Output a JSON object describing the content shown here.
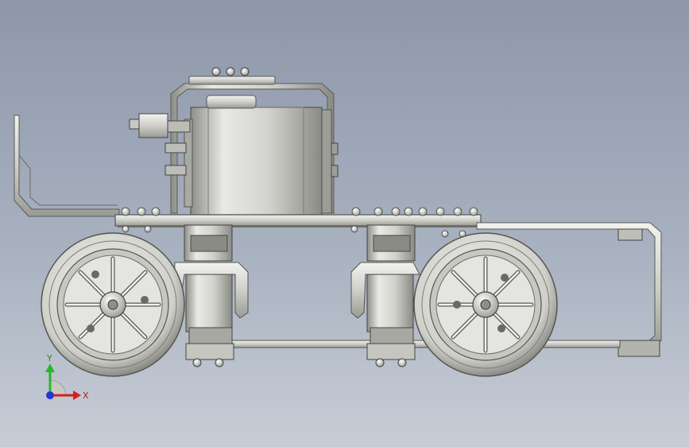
{
  "triad": {
    "x_label": "X",
    "y_label": "Y",
    "x_color": "#d42020",
    "y_color": "#2bb52b",
    "z_color": "#1f3ad6"
  },
  "model": {
    "steel_light": "#e6e6e2",
    "steel_mid": "#b9b9b4",
    "steel_dark": "#555550",
    "tire_color": "#d7d7d2"
  }
}
